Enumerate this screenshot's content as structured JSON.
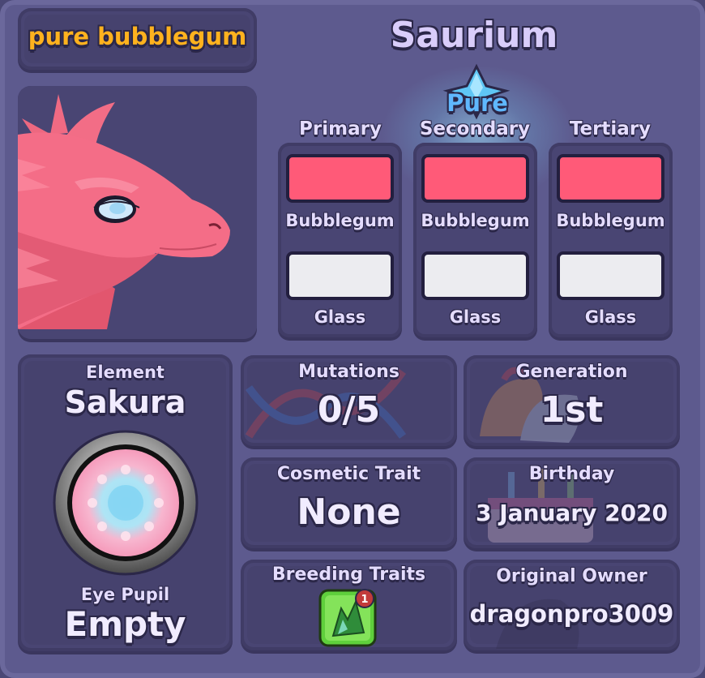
{
  "dragon": {
    "name": "pure bubblegum",
    "species": "Saurium"
  },
  "colors": {
    "badge": "Pure",
    "columns": [
      {
        "header": "Primary",
        "color": "Bubblegum",
        "material": "Glass"
      },
      {
        "header": "Secondary",
        "color": "Bubblegum",
        "material": "Glass"
      },
      {
        "header": "Tertiary",
        "color": "Bubblegum",
        "material": "Glass"
      }
    ],
    "color_hex": "#ff5a78",
    "glass_hex": "#ececf0"
  },
  "element": {
    "label": "Element",
    "value": "Sakura",
    "eye_label": "Eye Pupil",
    "eye_value": "Empty"
  },
  "stats": {
    "mutations": {
      "label": "Mutations",
      "value": "0/5"
    },
    "generation": {
      "label": "Generation",
      "value": "1st"
    },
    "cosmetic": {
      "label": "Cosmetic Trait",
      "value": "None"
    },
    "birthday": {
      "label": "Birthday",
      "value": "3 January 2020"
    },
    "breeding": {
      "label": "Breeding Traits",
      "trait_count": "1",
      "trait_icon": "green-dragon-trait-icon"
    },
    "owner": {
      "label": "Original Owner",
      "value": "dragonpro3009"
    }
  }
}
